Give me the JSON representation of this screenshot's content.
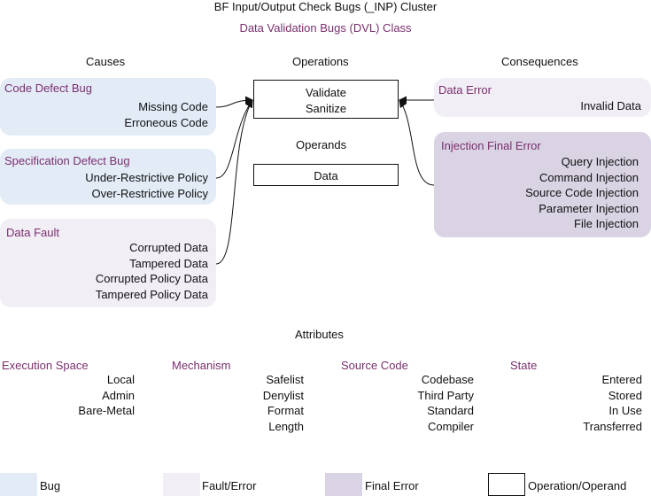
{
  "header": {
    "title": "BF Input/Output Check Bugs (_INP) Cluster",
    "class_title": "Data Validation Bugs (DVL) Class"
  },
  "columns": {
    "causes": "Causes",
    "operations": "Operations",
    "consequences": "Consequences",
    "operands": "Operands",
    "attributes": "Attributes"
  },
  "causes": [
    {
      "title": "Code Defect Bug",
      "items": [
        "Missing Code",
        "Erroneous Code"
      ]
    },
    {
      "title": "Specification Defect Bug",
      "items": [
        "Under-Restrictive Policy",
        "Over-Restrictive Policy"
      ]
    },
    {
      "title": "Data Fault",
      "items": [
        "Corrupted Data",
        "Tampered Data",
        "Corrupted Policy Data",
        "Tampered Policy Data"
      ]
    }
  ],
  "operations": {
    "items": [
      "Validate",
      "Sanitize"
    ]
  },
  "operands": {
    "items": [
      "Data"
    ]
  },
  "consequences": [
    {
      "title": "Data Error",
      "items": [
        "Invalid Data"
      ]
    },
    {
      "title": "Injection Final Error",
      "items": [
        "Query Injection",
        "Command Injection",
        "Source Code Injection",
        "Parameter Injection",
        "File Injection"
      ]
    }
  ],
  "attributes": [
    {
      "title": "Execution Space",
      "items": [
        "Local",
        "Admin",
        "Bare-Metal"
      ]
    },
    {
      "title": "Mechanism",
      "items": [
        "Safelist",
        "Denylist",
        "Format",
        "Length"
      ]
    },
    {
      "title": "Source Code",
      "items": [
        "Codebase",
        "Third Party",
        "Standard",
        "Compiler"
      ]
    },
    {
      "title": "State",
      "items": [
        "Entered",
        "Stored",
        "In Use",
        "Transferred"
      ]
    }
  ],
  "legend": {
    "bug": "Bug",
    "fault": "Fault/Error",
    "final": "Final Error",
    "operation": "Operation/Operand"
  },
  "colors": {
    "bug": "#e3ebf7",
    "fault": "#f1eef5",
    "final": "#d9d3e4",
    "accent": "#7a2e6e"
  }
}
